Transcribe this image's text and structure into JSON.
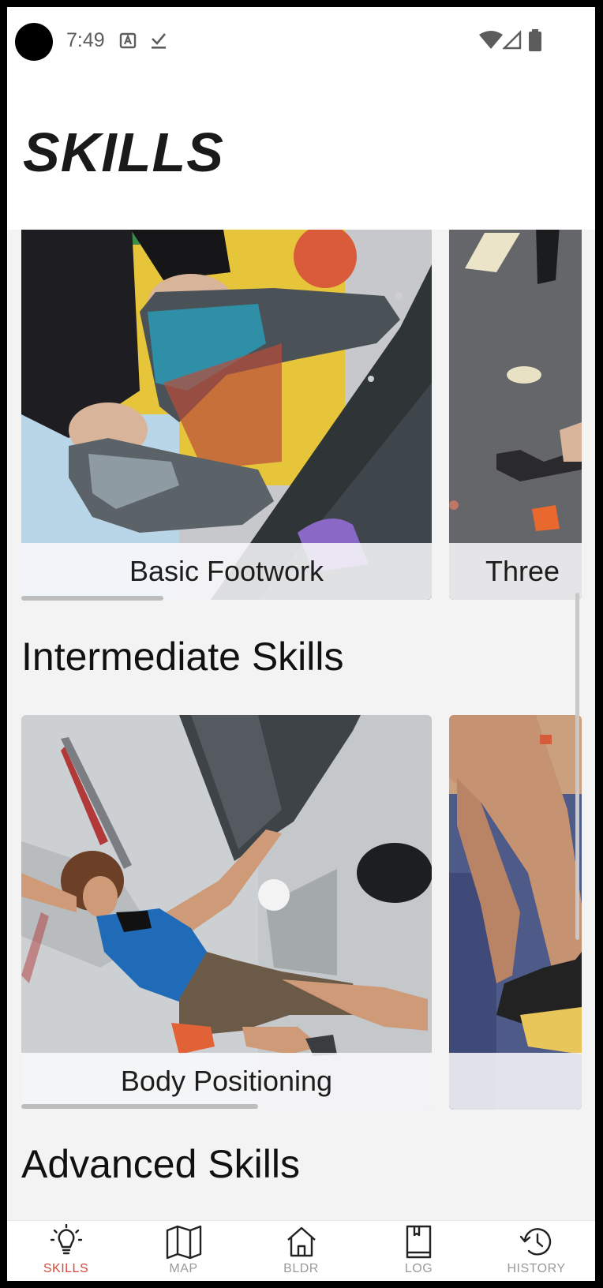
{
  "status_bar": {
    "time": "7:49",
    "icons": [
      "accessibility-icon",
      "download-done-icon",
      "wifi-icon",
      "signal-icon",
      "battery-icon"
    ]
  },
  "header": {
    "title": "SKILLS"
  },
  "sections": [
    {
      "title": "",
      "cards": [
        {
          "label": "Basic Footwork",
          "image": "climbing-shoes-on-wall-photo"
        },
        {
          "label": "Three",
          "image": "climbing-wall-holds-photo"
        }
      ]
    },
    {
      "title": "Intermediate Skills",
      "cards": [
        {
          "label": "Body Positioning",
          "image": "climber-on-overhang-photo"
        },
        {
          "label": "",
          "image": "climber-legs-photo"
        }
      ]
    },
    {
      "title": "Advanced Skills",
      "cards": []
    }
  ],
  "bottom_nav": {
    "items": [
      {
        "label": "SKILLS",
        "icon": "lightbulb-icon",
        "active": true
      },
      {
        "label": "MAP",
        "icon": "map-icon",
        "active": false
      },
      {
        "label": "BLDR",
        "icon": "home-icon",
        "active": false
      },
      {
        "label": "LOG",
        "icon": "book-icon",
        "active": false
      },
      {
        "label": "HISTORY",
        "icon": "history-icon",
        "active": false
      }
    ]
  },
  "colors": {
    "accent": "#d9483b",
    "inactive": "#9a9a9a",
    "background": "#f3f3f4"
  }
}
